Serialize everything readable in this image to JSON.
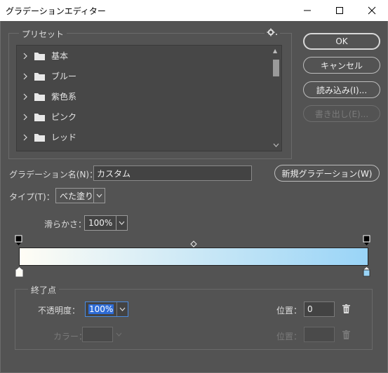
{
  "window": {
    "title": "グラデーションエディター"
  },
  "presets": {
    "group_label": "プリセット",
    "items": [
      {
        "label": "基本"
      },
      {
        "label": "ブルー"
      },
      {
        "label": "紫色系"
      },
      {
        "label": "ピンク"
      },
      {
        "label": "レッド"
      }
    ]
  },
  "buttons": {
    "ok": "OK",
    "cancel": "キャンセル",
    "load": "読み込み(I)...",
    "save": "書き出し(E)...",
    "new": "新規グラデーション(W)"
  },
  "name": {
    "label": "グラデーション名(N)：",
    "value": "カスタム"
  },
  "type": {
    "label": "タイプ(T)：",
    "value": "べた塗り"
  },
  "smoothness": {
    "label": "滑らかさ：",
    "value": "100%"
  },
  "gradient": {
    "start_color": "#fffdf5",
    "end_color": "#99d4f7"
  },
  "stops": {
    "group_label": "終了点",
    "opacity_label": "不透明度：",
    "opacity_value": "100%",
    "position_label": "位置：",
    "position_value": "0",
    "color_label": "カラー：",
    "color_position_label": "位置：",
    "color_position_value": ""
  },
  "icons": {
    "gear": "gear-icon",
    "trash": "trash-icon",
    "folder": "folder-icon"
  }
}
